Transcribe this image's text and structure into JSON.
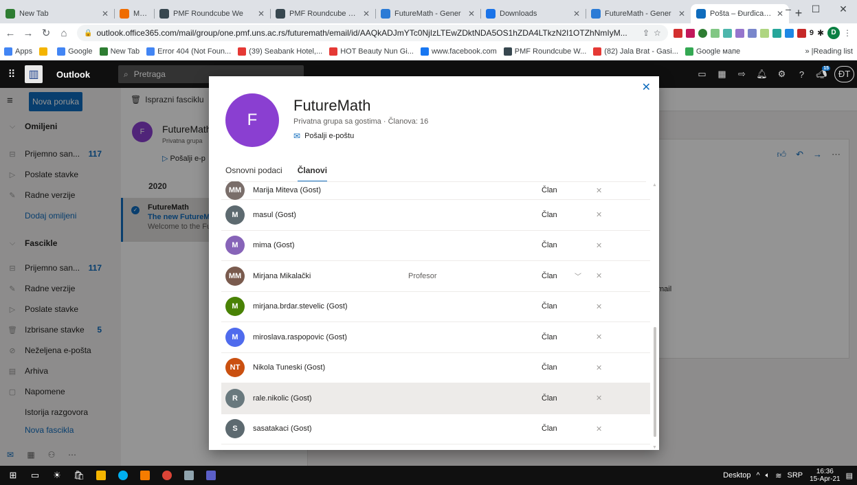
{
  "browser": {
    "tabs": [
      {
        "title": "New Tab",
        "color": "#2e7d32",
        "active": false
      },
      {
        "title": "MyWay",
        "color": "#ef6c00",
        "active": false
      },
      {
        "title": "PMF Roundcube We",
        "color": "#37474f",
        "active": false
      },
      {
        "title": "PMF Roundcube We",
        "color": "#37474f",
        "active": false
      },
      {
        "title": "FutureMath - Gener",
        "color": "#2b7bd6",
        "active": false
      },
      {
        "title": "Downloads",
        "color": "#1a73e8",
        "active": false
      },
      {
        "title": "FutureMath - Gener",
        "color": "#2b7bd6",
        "active": false
      },
      {
        "title": "Pošta – Đurđica Tak",
        "color": "#0f6cbd",
        "active": true
      }
    ],
    "url": "outlook.office365.com/mail/group/one.pmf.uns.ac.rs/futuremath/email/id/AAQkADJmYTc0NjIzLTEwZDktNDA5OS1hZDA4LTkzN2I1OTZhNmIyM...",
    "profile_initial": "D",
    "bookmarks": [
      "Apps",
      "",
      "Google",
      "New Tab",
      "Error 404 (Not Foun...",
      "(39) Seabank Hotel,...",
      "HOT Beauty Nun Gi...",
      "www.facebook.com",
      "PMF Roundcube W...",
      "(82) Jala Brat - Gasi...",
      "Google мапе"
    ],
    "reading_list": "Reading list",
    "new_tab_symbol": "+",
    "min_symbol": "–",
    "max_symbol": "☐",
    "close_symbol": "✕"
  },
  "outlook": {
    "app_title": "Outlook",
    "search_placeholder": "Pretraga",
    "notification_count": "15",
    "user_initials": "ĐT",
    "new_message": "Nova poruka",
    "empty_folder": "Isprazni fasciklu",
    "nav": {
      "favorites": "Omiljeni",
      "inbox": "Prijemno san...",
      "inbox_count": "117",
      "sent": "Poslate stavke",
      "drafts": "Radne verzije",
      "add_favorite": "Dodaj omiljeni",
      "folders": "Fascikle",
      "inbox2": "Prijemno san...",
      "inbox2_count": "117",
      "drafts2": "Radne verzije",
      "sent2": "Poslate stavke",
      "deleted": "Izbrisane stavke",
      "deleted_count": "5",
      "junk": "Neželjena e-pošta",
      "archive": "Arhiva",
      "notes": "Napomene",
      "history": "Istorija razgovora",
      "new_folder": "Nova fascikla"
    },
    "list": {
      "group_name": "FutureMath",
      "group_sub": "Privatna grupa",
      "send_mail": "Pošalji e-p",
      "year": "2020",
      "item_sender": "FutureMath",
      "item_subject": "The new FutureMa",
      "item_preview": "Welcome to the Fu"
    },
    "reading_partial": "mail"
  },
  "dialog": {
    "initial": "F",
    "name": "FutureMath",
    "subtitle": "Privatna grupa sa gostima · Članova: 16",
    "send_email": "Pošalji e-poštu",
    "tabs": {
      "basic": "Osnovni podaci",
      "members": "Članovi"
    },
    "members": [
      {
        "initials": "MM",
        "name": "Marija Miteva (Gost)",
        "title": "",
        "role": "Član",
        "color": "#7a6e6a",
        "partial": true
      },
      {
        "initials": "M",
        "name": "masul (Gost)",
        "title": "",
        "role": "Član",
        "color": "#5d6a70"
      },
      {
        "initials": "M",
        "name": "mima (Gost)",
        "title": "",
        "role": "Član",
        "color": "#8764b8"
      },
      {
        "initials": "MM",
        "name": "Mirjana Mikalački",
        "title": "Profesor",
        "role": "Član",
        "color": "#7a5b4e",
        "chevron": true
      },
      {
        "initials": "M",
        "name": "mirjana.brdar.stevelic (Gost)",
        "title": "",
        "role": "Član",
        "color": "#498205"
      },
      {
        "initials": "M",
        "name": "miroslava.raspopovic (Gost)",
        "title": "",
        "role": "Član",
        "color": "#4f6bed"
      },
      {
        "initials": "NT",
        "name": "Nikola Tuneski (Gost)",
        "title": "",
        "role": "Član",
        "color": "#ca5010"
      },
      {
        "initials": "R",
        "name": "rale.nikolic (Gost)",
        "title": "",
        "role": "Član",
        "color": "#69797e",
        "highlight": true
      },
      {
        "initials": "S",
        "name": "sasatakaci (Gost)",
        "title": "",
        "role": "Član",
        "color": "#5d6a70"
      }
    ]
  },
  "taskbar": {
    "desktop": "Desktop",
    "lang": "SRP",
    "time": "16:36",
    "date": "15-Apr-21"
  }
}
